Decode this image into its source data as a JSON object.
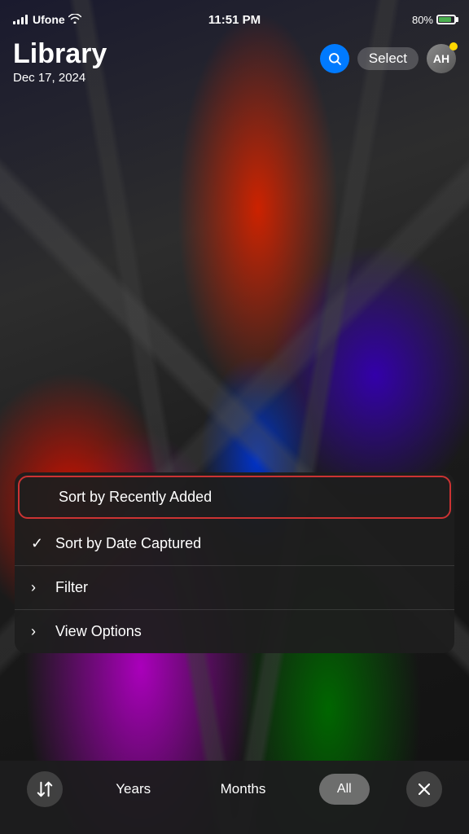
{
  "status_bar": {
    "carrier": "Ufone",
    "time": "11:51 PM",
    "battery_percent": "80%",
    "battery_icon_label": "battery-icon"
  },
  "header": {
    "title": "Library",
    "date": "Dec 17, 2024",
    "search_label": "search-button",
    "select_label": "Select",
    "avatar_initials": "AH"
  },
  "dropdown": {
    "items": [
      {
        "id": "sort-recently",
        "prefix": "",
        "label": "Sort by Recently Added",
        "has_check": false,
        "active": true
      },
      {
        "id": "sort-date",
        "prefix": "✓",
        "label": "Sort by Date Captured",
        "has_check": true,
        "active": false
      },
      {
        "id": "filter",
        "prefix": ">",
        "label": "Filter",
        "has_check": false,
        "active": false
      },
      {
        "id": "view-options",
        "prefix": ">",
        "label": "View Options",
        "has_check": false,
        "active": false
      }
    ]
  },
  "bottom_toolbar": {
    "sort_icon_label": "sort-icon",
    "years_label": "Years",
    "months_label": "Months",
    "all_label": "All",
    "close_label": "close-icon"
  }
}
